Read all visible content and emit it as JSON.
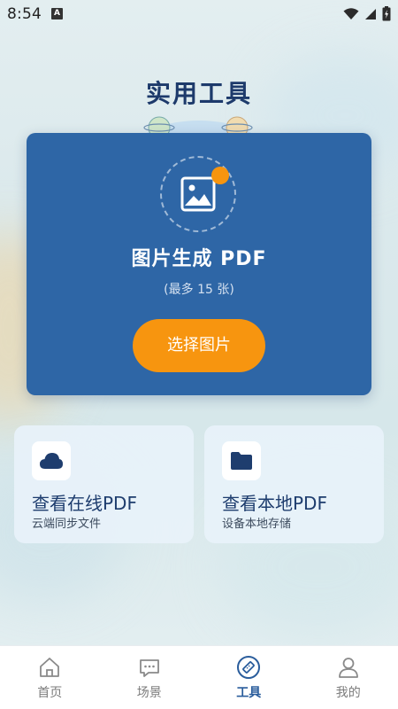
{
  "status_bar": {
    "time": "8:54",
    "notification_icon_letter": "A"
  },
  "page_title": "实用工具",
  "main_card": {
    "title": "图片生成 PDF",
    "subtitle": "(最多 15 张)",
    "button_label": "选择图片",
    "accent_color": "#f7950f",
    "background_color": "#2e66a6"
  },
  "tools": [
    {
      "title": "查看在线PDF",
      "description": "云端同步文件",
      "icon": "cloud-icon"
    },
    {
      "title": "查看本地PDF",
      "description": "设备本地存储",
      "icon": "folder-icon"
    }
  ],
  "bottom_nav": {
    "active": "tools",
    "items": [
      {
        "label": "首页",
        "icon": "home-icon"
      },
      {
        "label": "场景",
        "icon": "chat-icon"
      },
      {
        "label": "工具",
        "icon": "tool-icon"
      },
      {
        "label": "我的",
        "icon": "user-icon"
      }
    ]
  }
}
